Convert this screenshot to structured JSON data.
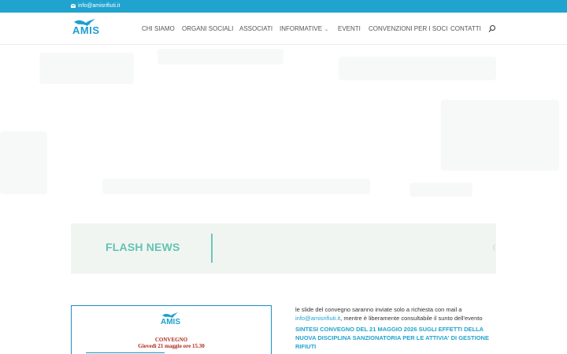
{
  "topbar": {
    "email": "info@amisrifiuti.it",
    "icon": "mail-icon",
    "bg_color": "#21a3cf"
  },
  "header": {
    "logo_text": "AMIS",
    "nav": [
      {
        "label": "CHI SIAMO"
      },
      {
        "label": "ORGANI SOCIALI"
      },
      {
        "label": "ASSOCIATI"
      },
      {
        "label": "INFORMATIVE",
        "has_dropdown": true
      },
      {
        "label": "EVENTI"
      },
      {
        "label": "CONVENZIONI PER I SOCI"
      },
      {
        "label": "CONTATTI"
      }
    ],
    "search_icon": "search-icon"
  },
  "flash": {
    "title": "FLASH NEWS",
    "accent_color": "#62c3b2",
    "ticker_text": "("
  },
  "poster": {
    "logo_text": "AMIS",
    "title": "CONVEGNO",
    "date": "Giovedì 21 maggio ore 15.30"
  },
  "article": {
    "text_before": "le slide del convegno saranno inviate solo a richiesta con mail a",
    "email_link": "info@amisrifiuti.it",
    "text_after": ", mentre è liberamente consultabile il sunto dell'evento",
    "heading_link": "SINTESI CONVEGNO DEL 21 MAGGIO 2026 SUGLI EFFETTI DELLA NUOVA DISCIPLINA SANZIONATORIA PER LE ATTIVIA' DI GESTIONE RIFIUTI"
  }
}
